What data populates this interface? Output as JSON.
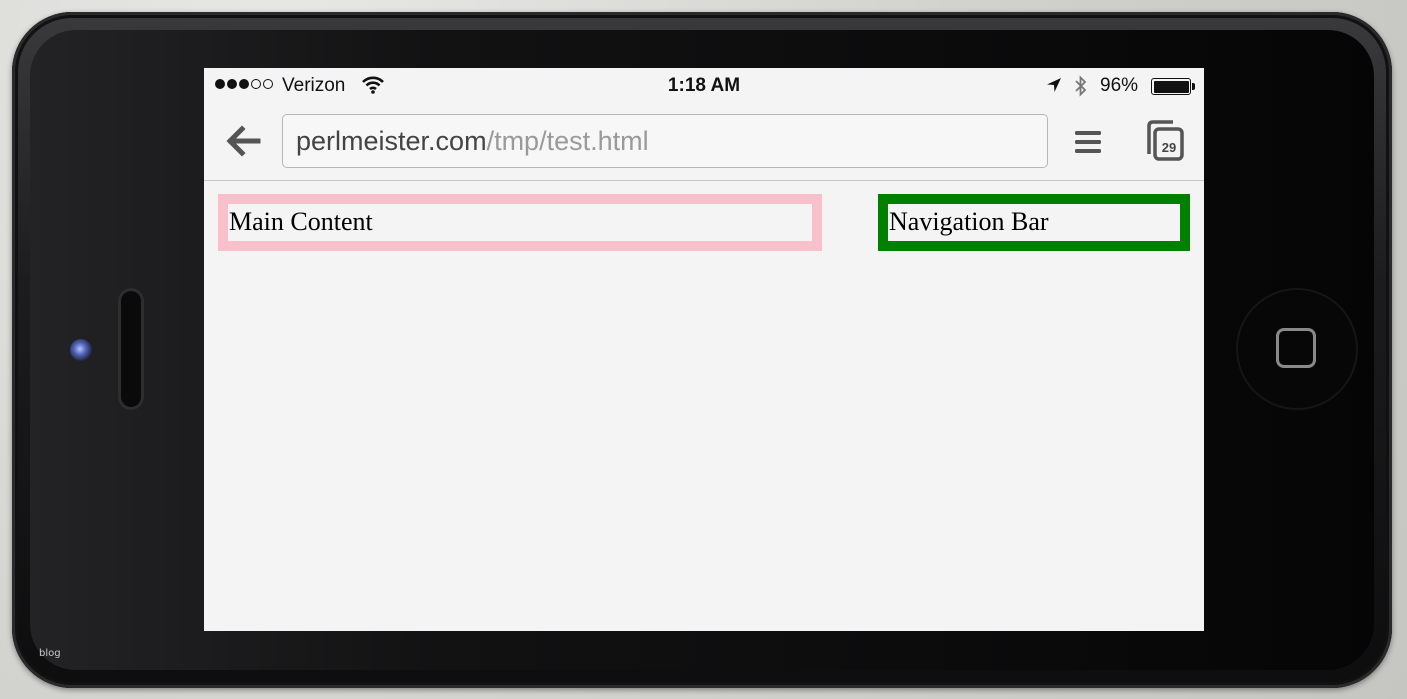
{
  "status_bar": {
    "signal_bars_filled": 3,
    "signal_bars_total": 5,
    "carrier": "Verizon",
    "time": "1:18 AM",
    "battery_percent": "96%"
  },
  "browser": {
    "url_domain": "perlmeister.com",
    "url_path": "/tmp/test.html",
    "tab_count": "29"
  },
  "page": {
    "main_content_label": "Main Content",
    "navigation_bar_label": "Navigation Bar"
  },
  "colors": {
    "main_content_border": "#f9c0cb",
    "navigation_bar_border": "#008000"
  },
  "watermark": "blog"
}
